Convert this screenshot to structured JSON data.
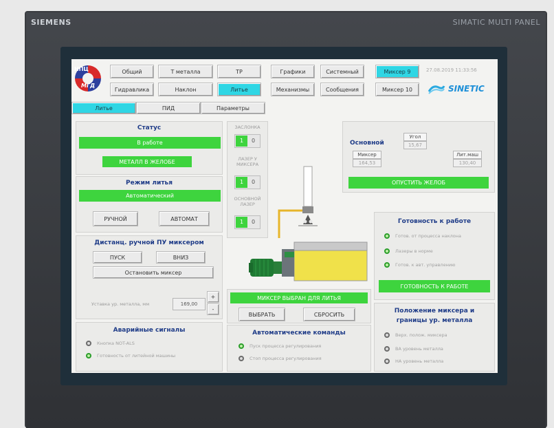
{
  "device": {
    "brand": "SIEMENS",
    "model": "SIMATIC MULTI PANEL"
  },
  "logo": {
    "text_top": "НПЦ",
    "text_bottom": "МГД"
  },
  "datetime": "27.08.2019 11:33:56",
  "sinetic": "SINETIC",
  "nav": {
    "row1": [
      "Общий",
      "Т металла",
      "ТР",
      "Графики",
      "Системный",
      "Миксер 9"
    ],
    "row2": [
      "Гидравлика",
      "Наклон",
      "Литье",
      "Механизмы",
      "Сообщения",
      "Миксер 10"
    ],
    "row1_active": "Миксер 9",
    "row2_active": "Литье"
  },
  "subtabs": {
    "items": [
      "Литье",
      "ПИД",
      "Параметры"
    ],
    "active": "Литье"
  },
  "status": {
    "title": "Статус",
    "state": "В работе",
    "metal": "МЕТАЛЛ В ЖЕЛОБЕ"
  },
  "mode": {
    "title": "Режим литья",
    "value": "Автоматический",
    "manual_btn": "РУЧНОЙ",
    "auto_btn": "АВТОМАТ"
  },
  "remote": {
    "title": "Дистанц. ручной ПУ миксером",
    "start_btn": "ПУСК",
    "down_btn": "ВНИЗ",
    "stop_btn": "Остановить миксер",
    "setpoint_label": "Уставка ур. металла, мм",
    "setpoint_value": "169,00",
    "plus": "+",
    "minus": "-"
  },
  "alarms": {
    "title": "Аварийные сигналы",
    "items": [
      {
        "label": "Кнопка NOT-ALS",
        "state": "off"
      },
      {
        "label": "Готовность от литейной машины",
        "state": "on"
      }
    ]
  },
  "switches": [
    {
      "label": "ЗАСЛОНКА",
      "on": "1",
      "off": "0"
    },
    {
      "label": "ЛАЗЕР У МИКСЕРА",
      "on": "1",
      "off": "0"
    },
    {
      "label": "ОСНОВНОЙ ЛАЗЕР",
      "on": "1",
      "off": "0"
    }
  ],
  "main_readout": {
    "title": "Основной",
    "mixer_label": "Миксер",
    "mixer_value": "164,53",
    "angle_label": "Угол",
    "angle_value": "15,67",
    "casting_label": "Лит.маш",
    "casting_value": "130,40",
    "lower_btn": "ОПУСТИТЬ ЖЕЛОБ"
  },
  "mixer_select": {
    "status": "МИКСЕР ВЫБРАН ДЛЯ ЛИТЬЯ",
    "select_btn": "ВЫБРАТЬ",
    "reset_btn": "СБРОСИТЬ"
  },
  "auto_cmds": {
    "title": "Автоматические команды",
    "items": [
      {
        "label": "Пуск процесса регулирования",
        "state": "on"
      },
      {
        "label": "Стоп процесса регулирования",
        "state": "off"
      }
    ]
  },
  "ready": {
    "title": "Готовность к работе",
    "items": [
      {
        "label": "Готов. от процесса наклона",
        "state": "on"
      },
      {
        "label": "Лазеры в норме",
        "state": "on"
      },
      {
        "label": "Готов. к авт. управлению",
        "state": "on"
      }
    ],
    "button": "ГОТОВНОСТЬ К РАБОТЕ"
  },
  "position": {
    "title_line1": "Положение миксера и",
    "title_line2": "границы ур. металла",
    "items": [
      {
        "label": "Верх. полож. миксера",
        "state": "off"
      },
      {
        "label": "ВА уровень металла",
        "state": "off"
      },
      {
        "label": "НА уровень металла",
        "state": "off"
      }
    ]
  },
  "colors": {
    "active_tab": "#2fd6e4",
    "ok_green": "#3ed43e",
    "title_blue": "#1f3c88",
    "metal_yellow": "#f0e14a"
  }
}
